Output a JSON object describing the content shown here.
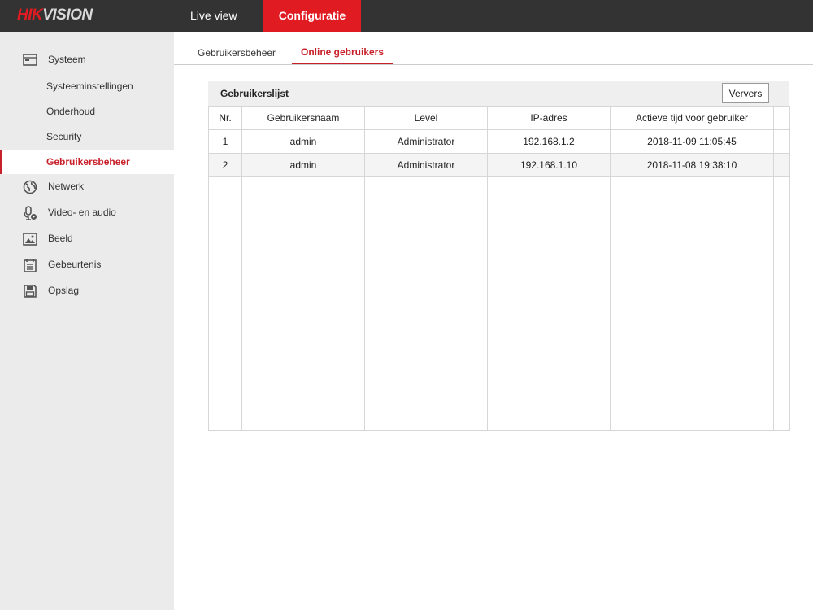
{
  "header": {
    "logo": {
      "part1": "HIK",
      "part2": "VISION"
    },
    "nav": [
      {
        "label": "Live view"
      },
      {
        "label": "Configuratie"
      }
    ]
  },
  "sidebar": {
    "groups": [
      {
        "label": "Systeem",
        "icon": "monitor-icon"
      },
      {
        "label": "Netwerk",
        "icon": "globe-icon"
      },
      {
        "label": "Video- en audio",
        "icon": "microphone-icon"
      },
      {
        "label": "Beeld",
        "icon": "image-icon"
      },
      {
        "label": "Gebeurtenis",
        "icon": "calendar-icon"
      },
      {
        "label": "Opslag",
        "icon": "floppy-disk-icon"
      }
    ],
    "system_subitems": [
      {
        "label": "Systeeminstellingen"
      },
      {
        "label": "Onderhoud"
      },
      {
        "label": "Security"
      },
      {
        "label": "Gebruikersbeheer"
      }
    ]
  },
  "tabs": [
    {
      "label": "Gebruikersbeheer"
    },
    {
      "label": "Online gebruikers"
    }
  ],
  "panel": {
    "title": "Gebruikerslijst",
    "refresh_label": "Ververs"
  },
  "table": {
    "columns": [
      "Nr.",
      "Gebruikersnaam",
      "Level",
      "IP-adres",
      "Actieve tijd voor gebruiker"
    ],
    "rows": [
      [
        "1",
        "admin",
        "Administrator",
        "192.168.1.2",
        "2018-11-09 11:05:45"
      ],
      [
        "2",
        "admin",
        "Administrator",
        "192.168.1.10",
        "2018-11-08 19:38:10"
      ]
    ]
  },
  "colors": {
    "accent": "#e01b22",
    "topbar": "#333333",
    "sidebar": "#ebebeb"
  }
}
